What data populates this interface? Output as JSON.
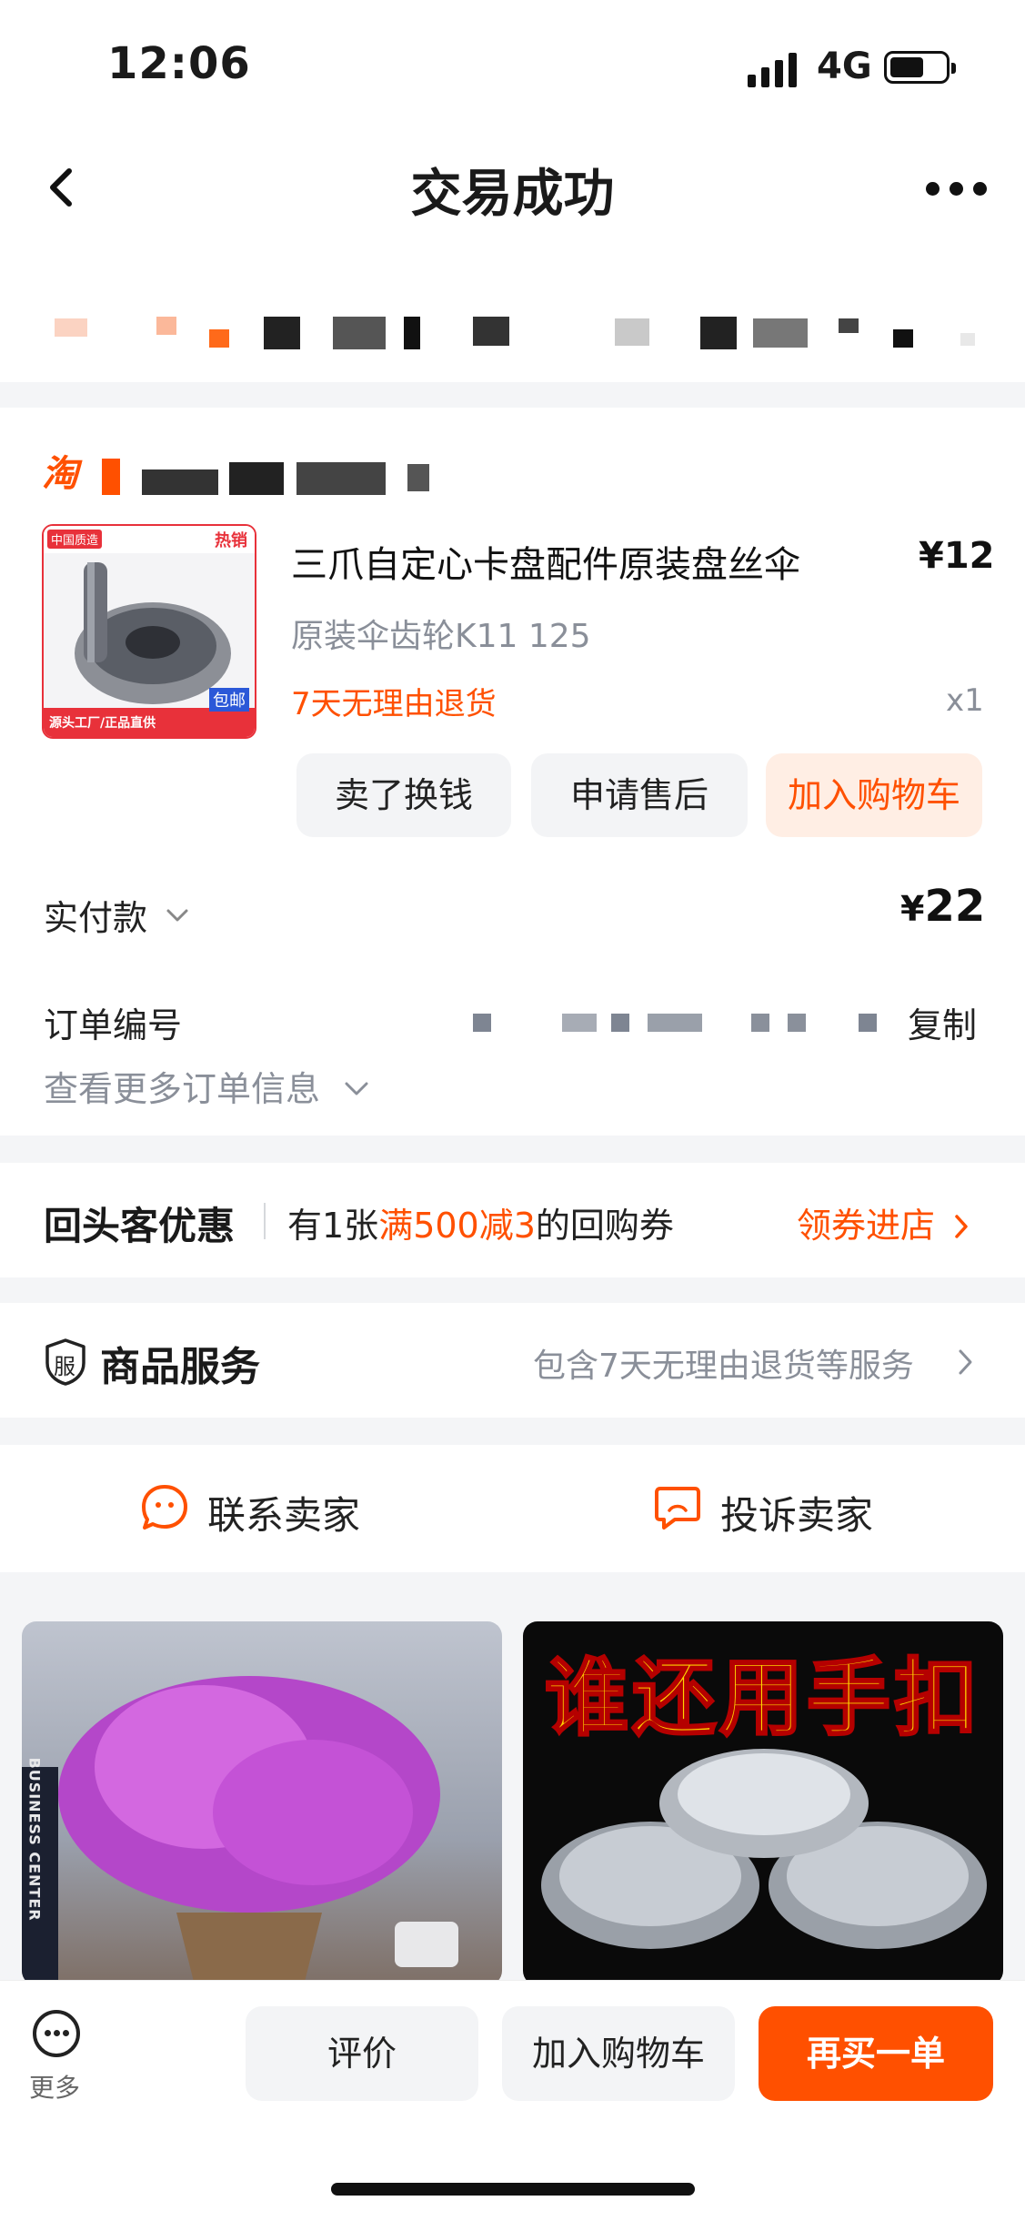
{
  "status_bar": {
    "time": "12:06",
    "network": "4G"
  },
  "nav": {
    "title": "交易成功"
  },
  "shop": {
    "logo_text": "淘"
  },
  "product": {
    "title": "三爪自定心卡盘配件原装盘丝伞",
    "price": "¥12",
    "spec": "原装伞齿轮K11 125",
    "tag": "7天无理由退货",
    "qty": "x1",
    "image_badge_left": "中国质造",
    "image_badge_right": "热销",
    "image_footer": "源头工厂/正品直供",
    "image_footer_right": "包邮"
  },
  "actions": {
    "sell": "卖了换钱",
    "after_sale": "申请售后",
    "add_cart": "加入购物车"
  },
  "payment": {
    "label": "实付款",
    "currency": "¥",
    "amount": "22"
  },
  "order": {
    "number_label": "订单编号",
    "copy": "复制",
    "more_info": "查看更多订单信息"
  },
  "return_customer": {
    "title": "回头客优惠",
    "text_prefix": "有1张",
    "text_highlight": "满500减3",
    "text_suffix": "的回购券",
    "link": "领券进店"
  },
  "service": {
    "icon_text": "服",
    "title": "商品服务",
    "desc": "包含7天无理由退货等服务"
  },
  "contact": {
    "contact_seller": "联系卖家",
    "complain_seller": "投诉卖家"
  },
  "recommendations": {
    "right_text": "谁还用手扣",
    "left_side_text": "BUSINESS CENTER"
  },
  "bottom_bar": {
    "more": "更多",
    "review": "评价",
    "add_cart": "加入购物车",
    "buy_again": "再买一单"
  },
  "colors": {
    "accent": "#ff5000",
    "accent_light": "#ffeee4",
    "muted": "#8a8f99"
  }
}
